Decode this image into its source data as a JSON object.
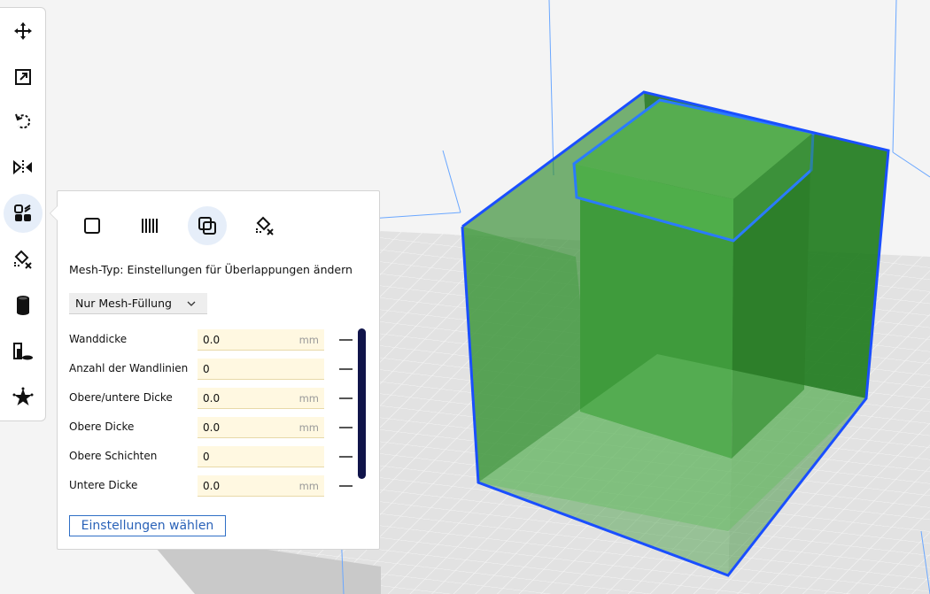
{
  "toolbar": {
    "tools": [
      {
        "icon": "move-icon"
      },
      {
        "icon": "scale-icon"
      },
      {
        "icon": "rotate-icon"
      },
      {
        "icon": "mirror-icon"
      },
      {
        "icon": "per-model-settings-icon",
        "active": true
      },
      {
        "icon": "support-blocker-icon"
      },
      {
        "icon": "cylinder-icon"
      },
      {
        "icon": "tool-object-icon"
      },
      {
        "icon": "star-icon"
      }
    ]
  },
  "panel": {
    "mesh_types": [
      {
        "icon": "normal-model-icon"
      },
      {
        "icon": "print-as-support-icon"
      },
      {
        "icon": "modify-overlaps-icon",
        "active": true
      },
      {
        "icon": "dont-support-overlaps-icon"
      }
    ],
    "mesh_type_title": "Mesh-Typ: Einstellungen für Überlappungen ändern",
    "dropdown_value": "Nur Mesh-Füllung",
    "settings": [
      {
        "label": "Wanddicke",
        "value": "0.0",
        "unit": "mm"
      },
      {
        "label": "Anzahl der Wandlinien",
        "value": "0",
        "unit": ""
      },
      {
        "label": "Obere/untere Dicke",
        "value": "0.0",
        "unit": "mm"
      },
      {
        "label": "Obere Dicke",
        "value": "0.0",
        "unit": "mm"
      },
      {
        "label": "Obere Schichten",
        "value": "0",
        "unit": ""
      },
      {
        "label": "Untere Dicke",
        "value": "0.0",
        "unit": "mm"
      }
    ],
    "choose_settings_label": "Einstellungen wählen"
  },
  "colors": {
    "accent": "#2a62b8",
    "model_green": "#3f9a3c",
    "outline_blue": "#1a4fff",
    "input_bg": "#fff8e1"
  }
}
